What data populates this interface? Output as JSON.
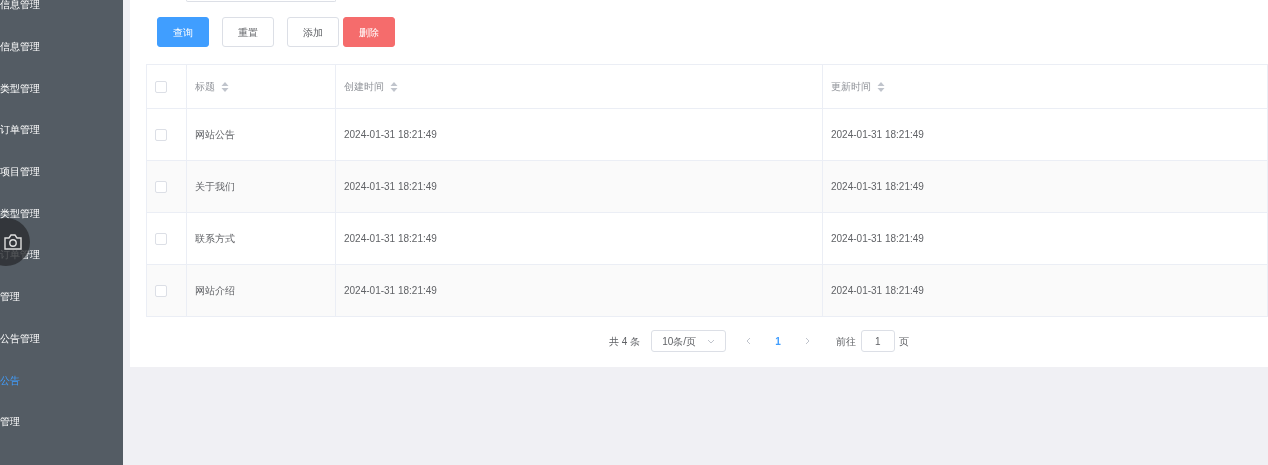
{
  "sidebar": {
    "items": [
      {
        "label": "信息管理",
        "selected": false
      },
      {
        "label": "信息管理",
        "selected": false
      },
      {
        "label": "类型管理",
        "selected": false
      },
      {
        "label": "订单管理",
        "selected": false
      },
      {
        "label": "项目管理",
        "selected": false
      },
      {
        "label": "类型管理",
        "selected": false
      },
      {
        "label": "订单管理",
        "selected": false
      },
      {
        "label": "管理",
        "selected": false
      },
      {
        "label": "公告管理",
        "selected": false
      },
      {
        "label": "公告",
        "selected": true
      },
      {
        "label": "管理",
        "selected": false
      }
    ]
  },
  "toolbar": {
    "buttons": [
      {
        "label": "查询",
        "kind": "primary"
      },
      {
        "label": "重置",
        "kind": "plain"
      },
      {
        "label": "添加",
        "kind": "plain"
      },
      {
        "label": "删除",
        "kind": "danger"
      }
    ]
  },
  "table": {
    "all_checked": false,
    "columns": [
      "标题",
      "创建时间",
      "更新时间"
    ],
    "rows": [
      {
        "checked": false,
        "cells": [
          "网站公告",
          "2024-01-31 18:21:49",
          "2024-01-31 18:21:49"
        ]
      },
      {
        "checked": false,
        "cells": [
          "关于我们",
          "2024-01-31 18:21:49",
          "2024-01-31 18:21:49"
        ]
      },
      {
        "checked": false,
        "cells": [
          "联系方式",
          "2024-01-31 18:21:49",
          "2024-01-31 18:21:49"
        ]
      },
      {
        "checked": false,
        "cells": [
          "网站介绍",
          "2024-01-31 18:21:49",
          "2024-01-31 18:21:49"
        ]
      }
    ]
  },
  "pagination": {
    "total": "共 4 条",
    "page_size": "10条/页",
    "pages": [
      {
        "label": "1",
        "selected": true
      }
    ],
    "goto_label": "前往",
    "goto_value": "1",
    "goto_suffix": "页"
  }
}
